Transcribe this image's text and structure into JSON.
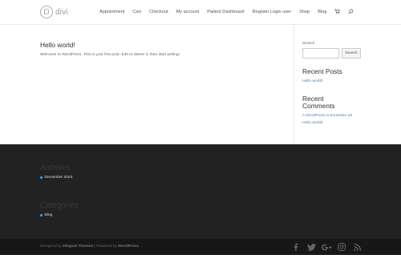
{
  "header": {
    "logo_letter": "D",
    "logo_text": "divi",
    "nav": [
      "Appointment",
      "Cart",
      "Checkout",
      "My account",
      "Patient Dashboard",
      "Register Login user",
      "Shop",
      "Blog"
    ],
    "icons": [
      "cart-icon",
      "search-icon"
    ]
  },
  "post": {
    "title": "Hello world!",
    "excerpt": "Welcome to WordPress. This is your first post. Edit or delete it, then start writing!"
  },
  "sidebar": {
    "search_label": "Search",
    "search_button": "Search",
    "search_value": "",
    "recent_posts_title": "Recent Posts",
    "recent_post_link": "Hello world!",
    "recent_comments_title_line1": "Recent",
    "recent_comments_title_line2": "Comments",
    "comment_author": "A WordPress Commenter",
    "comment_on": "on",
    "comment_post": "Hello world!"
  },
  "footer": {
    "archives_title": "Archives",
    "archive_item": "December 2023",
    "categories_title": "Categories",
    "category_item": "Blog"
  },
  "bottom_bar": {
    "designed_by": "Designed by",
    "theme_link": "Elegant Themes",
    "separator": "|",
    "powered_by": "Powered by",
    "wp_link": "WordPress",
    "social_icons": [
      "facebook-icon",
      "twitter-icon",
      "google-plus-icon",
      "instagram-icon",
      "rss-icon"
    ]
  },
  "colors": {
    "accent": "#2ea3f2",
    "footer_bg": "#222222",
    "bottom_bar_bg": "#171717"
  }
}
